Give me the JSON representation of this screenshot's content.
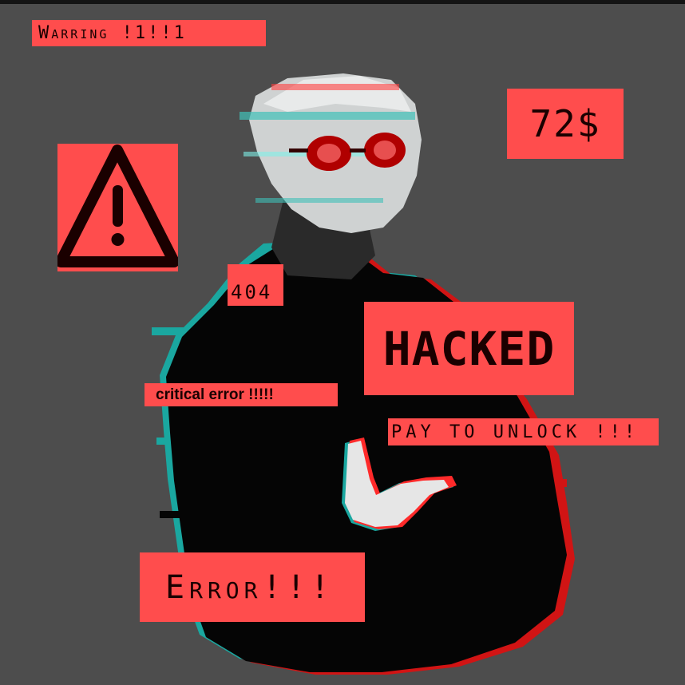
{
  "labels": {
    "warning": "Warring !1!!1",
    "price": "72$",
    "code": "404",
    "hacked": "HACKED",
    "critical": "critical error !!!!!",
    "pay": "PAY TO UNLOCK !!!",
    "error": "Error!!!"
  },
  "icons": {
    "warning": "warning-triangle-icon",
    "figure": "glitched-figure-silhouette"
  },
  "colors": {
    "background": "#4d4d4d",
    "label_background": "#ff4d4d",
    "label_text": "#1a0000",
    "glitch_cyan": "#1aa7a0",
    "glitch_red": "#ff2a2a",
    "figure_black": "#050505"
  }
}
